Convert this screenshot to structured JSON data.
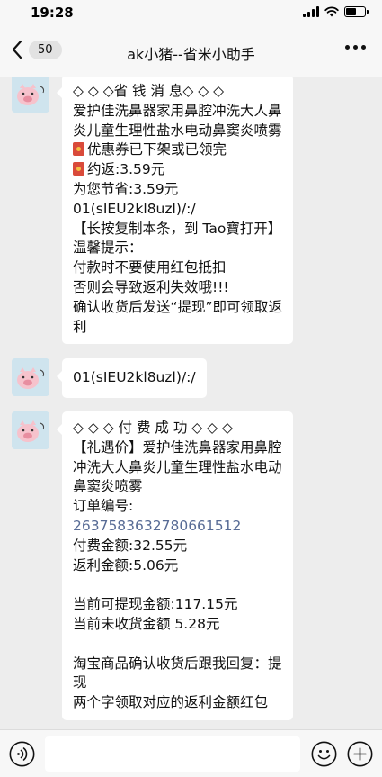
{
  "status_bar": {
    "time": "19:28",
    "battery_level": 0.55
  },
  "nav": {
    "back_count": "50",
    "title": "ak小猪--省米小助手"
  },
  "messages": [
    {
      "lines": [
        "◇ ◇ ◇省 钱 消 息◇ ◇ ◇",
        "爱护佳洗鼻器家用鼻腔冲洗大人鼻",
        "炎儿童生理性盐水电动鼻窦炎喷雾",
        "优惠券已下架或已领完",
        "约返:3.59元",
        "为您节省:3.59元",
        "01(sIEU2kl8uzl)/:/",
        "【长按复制本条，到 Tao寶打开】",
        "温馨提示：",
        "付款时不要使用红包抵扣",
        "否则会导致返利失效哦!!!",
        "确认收货后发送“提现”即可领取返",
        "利"
      ]
    },
    {
      "lines": [
        "01(sIEU2kl8uzl)/:/"
      ]
    },
    {
      "lines": [
        "◇ ◇ ◇ 付 费 成 功 ◇ ◇ ◇",
        "【礼遇价】爱护佳洗鼻器家用鼻腔",
        "冲洗大人鼻炎儿童生理性盐水电动",
        "鼻窦炎喷雾",
        "订单编号:",
        "2637583632780661512",
        "付费金额:32.55元",
        "返利金额:5.06元",
        "当前可提现金额:117.15元",
        "当前未收货金额 5.28元",
        "淘宝商品确认收货后跟我回复：提",
        "现",
        "两个字领取对应的返利金额红包"
      ]
    }
  ],
  "colors": {
    "order_link": "#576b95",
    "bubble": "#ffffff",
    "chat_bg": "#ededed"
  },
  "icons": {
    "avatar": "pig-sticker-icon",
    "redpacket": "red-packet-icon",
    "voice": "voice-icon",
    "emoji": "emoji-icon",
    "plus": "plus-icon"
  }
}
